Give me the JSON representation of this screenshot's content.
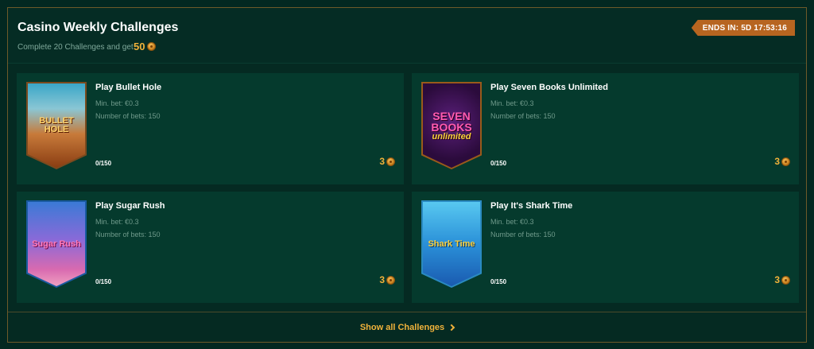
{
  "header": {
    "title": "Casino Weekly Challenges",
    "subtitle": "Complete 20 Challenges and get",
    "total_reward": "50",
    "ends_label": "ENDS IN: 5D 17:53:16"
  },
  "challenges": [
    {
      "title": "Play Bullet Hole",
      "min_bet": "Min. bet: €0.3",
      "num_bets": "Number of bets: 150",
      "progress": "0/150",
      "reward": "3",
      "thumb_text": "BULLET HOLE"
    },
    {
      "title": "Play Seven Books Unlimited",
      "min_bet": "Min. bet: €0.3",
      "num_bets": "Number of bets: 150",
      "progress": "0/150",
      "reward": "3",
      "thumb_text": "SEVEN BOOKS",
      "thumb_sub": "unlimited"
    },
    {
      "title": "Play Sugar Rush",
      "min_bet": "Min. bet: €0.3",
      "num_bets": "Number of bets: 150",
      "progress": "0/150",
      "reward": "3",
      "thumb_text": "Sugar Rush"
    },
    {
      "title": "Play It's Shark Time",
      "min_bet": "Min. bet: €0.3",
      "num_bets": "Number of bets: 150",
      "progress": "0/150",
      "reward": "3",
      "thumb_text": "Shark Time"
    }
  ],
  "footer": {
    "show_all_label": "Show all Challenges"
  },
  "colors": {
    "background": "#032821",
    "card": "#053a2d",
    "accent_gold": "#f0b23b",
    "badge": "#b76520",
    "border_gold": "#6e5a2a"
  },
  "icons": {
    "coin": "coin-icon",
    "chevron": "chevron-right-icon"
  }
}
